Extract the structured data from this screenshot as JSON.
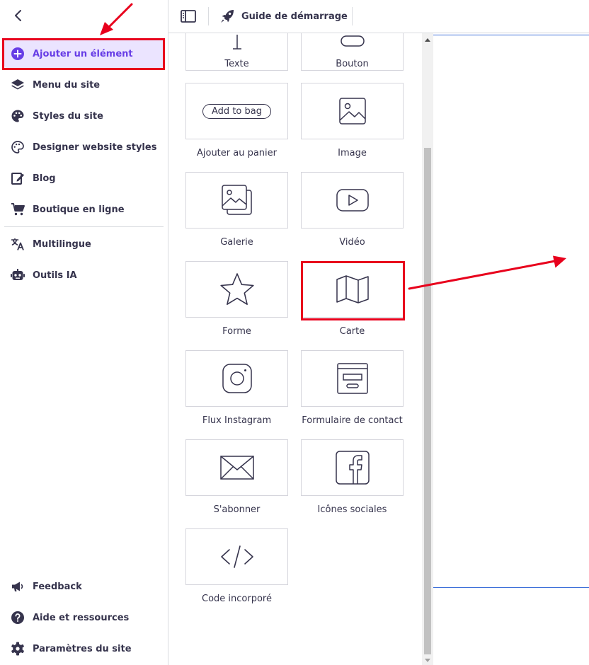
{
  "topbar": {
    "guide_label": "Guide de démarrage"
  },
  "sidebar": {
    "items": [
      {
        "label": "Ajouter un élément",
        "icon": "plus-circle-icon",
        "active": true
      },
      {
        "label": "Menu du site",
        "icon": "layers-icon"
      },
      {
        "label": "Styles du site",
        "icon": "palette-icon"
      },
      {
        "label": "Designer website styles",
        "icon": "palette-outline-icon"
      },
      {
        "label": "Blog",
        "icon": "edit-note-icon"
      },
      {
        "label": "Boutique en ligne",
        "icon": "cart-icon"
      },
      {
        "label": "Multilingue",
        "icon": "translate-icon"
      },
      {
        "label": "Outils IA",
        "icon": "robot-icon"
      }
    ],
    "bottom_items": [
      {
        "label": "Feedback",
        "icon": "megaphone-icon"
      },
      {
        "label": "Aide et ressources",
        "icon": "help-icon"
      },
      {
        "label": "Paramètres du site",
        "icon": "settings-icon"
      }
    ]
  },
  "elements": {
    "tiles": [
      {
        "label": "Texte",
        "icon": "text-icon"
      },
      {
        "label": "Bouton",
        "icon": "button-icon"
      },
      {
        "label": "Ajouter au panier",
        "icon": "add-to-bag-icon",
        "pill_text": "Add to bag"
      },
      {
        "label": "Image",
        "icon": "image-icon"
      },
      {
        "label": "Galerie",
        "icon": "gallery-icon"
      },
      {
        "label": "Vidéo",
        "icon": "video-icon"
      },
      {
        "label": "Forme",
        "icon": "star-icon"
      },
      {
        "label": "Carte",
        "icon": "map-icon"
      },
      {
        "label": "Flux Instagram",
        "icon": "instagram-icon"
      },
      {
        "label": "Formulaire de contact",
        "icon": "contact-form-icon"
      },
      {
        "label": "S'abonner",
        "icon": "envelope-icon"
      },
      {
        "label": "Icônes sociales",
        "icon": "facebook-icon"
      },
      {
        "label": "Code incorporé",
        "icon": "code-icon"
      }
    ]
  },
  "colors": {
    "accent": "#673de6",
    "active_bg": "#ebe4ff",
    "annotation_red": "#e8001c",
    "canvas_guide": "#3d6fd9"
  }
}
